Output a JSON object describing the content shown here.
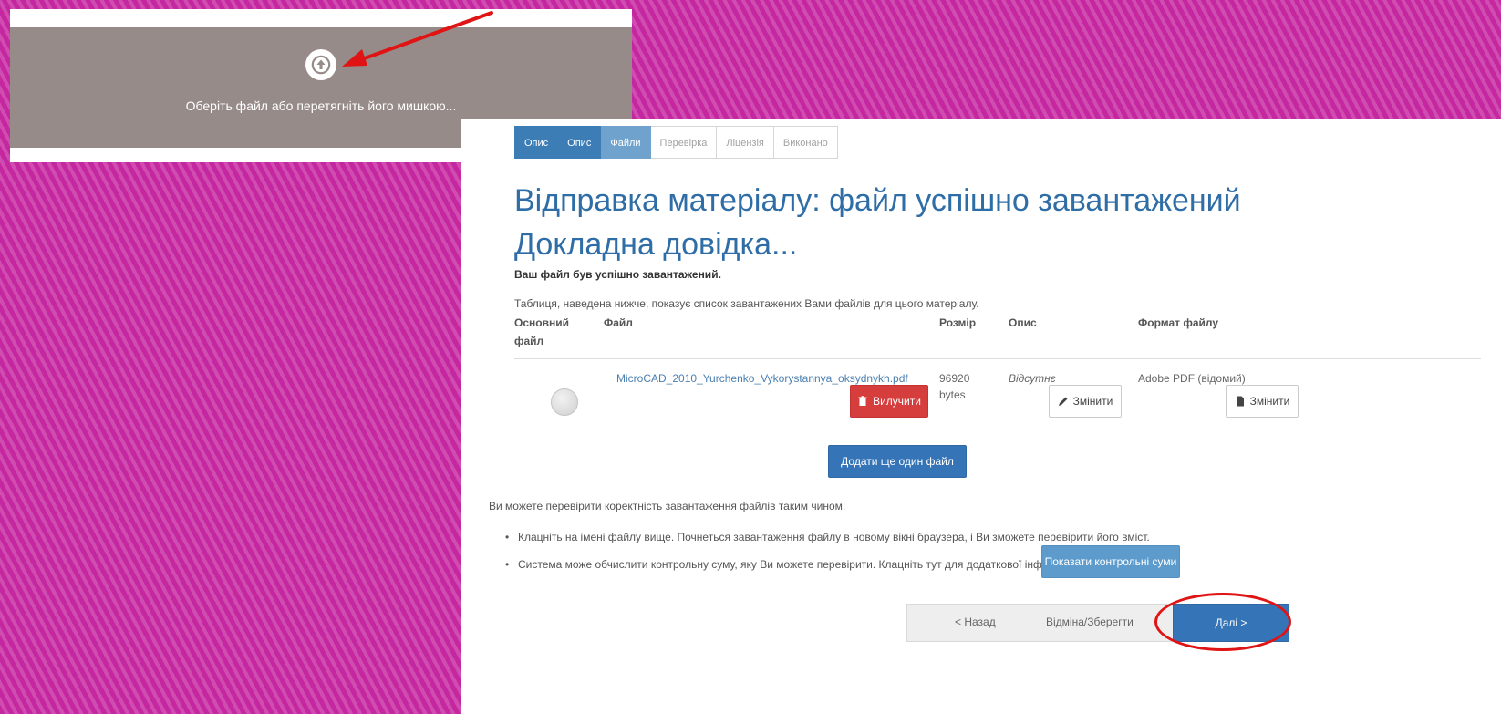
{
  "upload": {
    "prompt": "Оберіть файл або перетягніть його мишкою..."
  },
  "steps": [
    {
      "label": "Опис",
      "state": "done"
    },
    {
      "label": "Опис",
      "state": "done"
    },
    {
      "label": "Файли",
      "state": "current"
    },
    {
      "label": "Перевірка",
      "state": "pending"
    },
    {
      "label": "Ліцензія",
      "state": "pending"
    },
    {
      "label": "Виконано",
      "state": "pending"
    }
  ],
  "page": {
    "title": "Відправка матеріалу: файл успішно завантажений Докладна довідка...",
    "success_note": "Ваш файл був успішно завантажений.",
    "intro": "Таблиця, наведена нижче, показує список завантажених Вами файлів для цього матеріалу."
  },
  "table": {
    "headers": {
      "primary_line1": "Основний",
      "primary_line2": "файл",
      "file": "Файл",
      "size": "Розмір",
      "description": "Опис",
      "format": "Формат файлу"
    },
    "row": {
      "filename": "MicroCAD_2010_Yurchenko_Vykorystannya_oksydnykh.pdf",
      "remove_label": "Вилучити",
      "size_value": "96920",
      "size_unit": "bytes",
      "description_value": "Відсутнє",
      "description_change_label": "Змінити",
      "format_value": "Adobe PDF (відомий)",
      "format_change_label": "Змінити"
    },
    "add_file_label": "Додати ще один файл"
  },
  "verify": {
    "intro": "Ви можете перевірити коректність завантаження файлів таким чином.",
    "bullet1": "Клацніть на імені файлу вище. Почнеться завантаження файлу в новому вікні браузера, і Ви зможете перевірити його вміст.",
    "bullet2": "Система може обчислити контрольну суму, яку Ви можете перевірити. Клацніть тут для додаткової інформації.",
    "checksum_label": "Показати контрольні суми"
  },
  "nav": {
    "back_label": "< Назад",
    "cancel_label": "Відміна/Зберегти",
    "next_label": "Далі >"
  },
  "colors": {
    "background": "#c2289e",
    "accent": "#3575b7",
    "danger": "#d63e3e",
    "annotation": "#e01414"
  }
}
